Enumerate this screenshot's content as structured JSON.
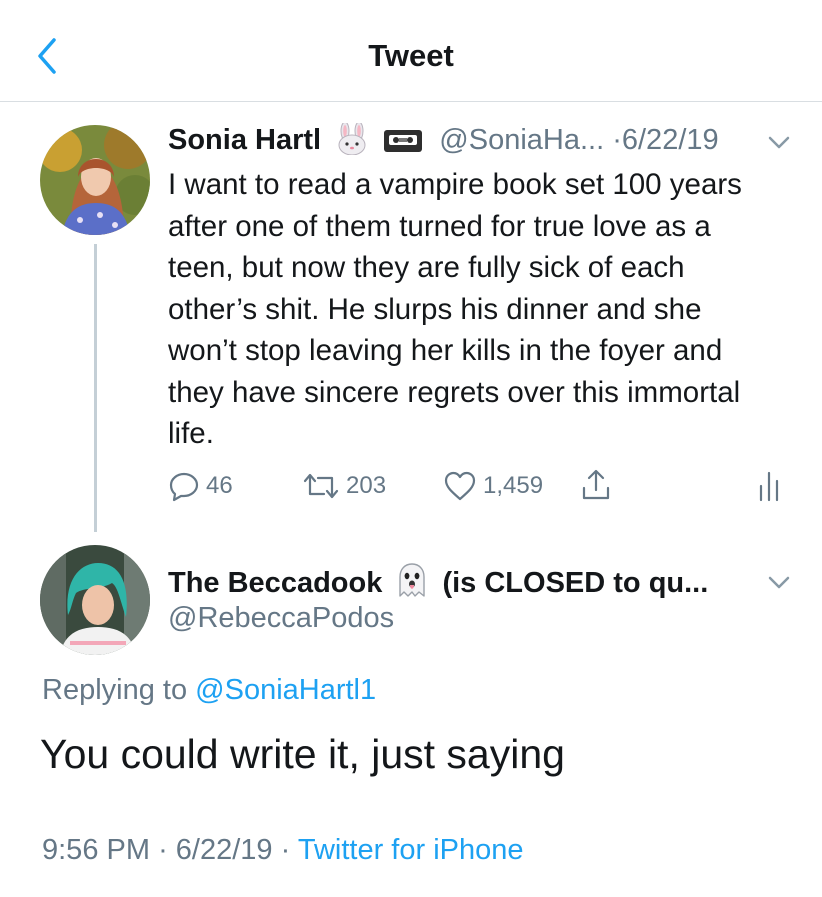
{
  "header": {
    "title": "Tweet"
  },
  "tweet": {
    "author_name": "Sonia Hartl",
    "name_emoji_1": "rabbit-face",
    "name_emoji_2": "videocassette",
    "handle": "@SoniaHa...",
    "separator": "·",
    "date": "6/22/19",
    "text": "I want to read a vampire book set 100 years after one of them turned for true love as a teen, but now they are fully sick of each other’s shit. He slurps his dinner and she won’t stop leaving her kills in the foyer and they have sincere regrets over this immortal life.",
    "stats": {
      "replies": "46",
      "retweets": "203",
      "likes": "1,459"
    }
  },
  "reply": {
    "author_name": "The Beccadook",
    "name_emoji": "ghost",
    "name_suffix": "(is CLOSED to qu...",
    "handle": "@RebeccaPodos",
    "replying_prefix": "Replying to",
    "replying_to": "@SoniaHartl1",
    "text": "You could write it, just saying",
    "time": "9:56 PM",
    "separator": "·",
    "date": "6/22/19",
    "source": "Twitter for iPhone"
  },
  "colors": {
    "accent": "#1da1f2",
    "muted": "#657786",
    "text": "#14171a",
    "divider": "#d9dee2",
    "thread_line": "#c4cfd6"
  }
}
